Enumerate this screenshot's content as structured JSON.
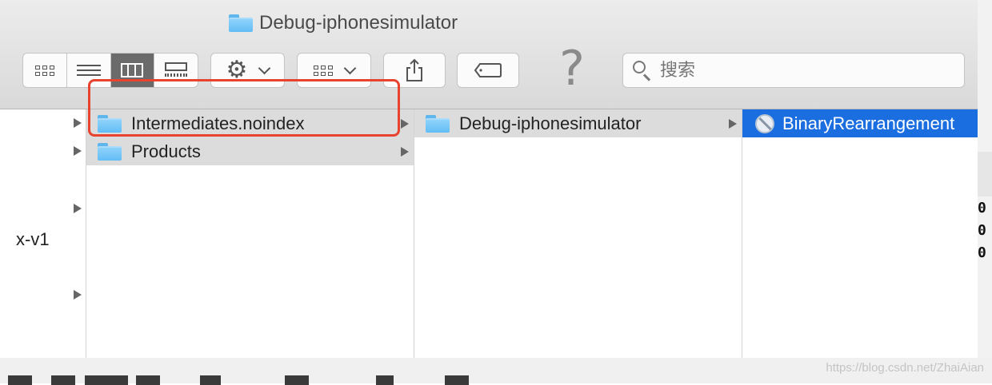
{
  "window": {
    "title": "Debug-iphonesimulator",
    "title_icon": "folder-icon"
  },
  "toolbar": {
    "view_modes": [
      "icon-view-icon",
      "list-view-icon",
      "column-view-icon",
      "gallery-view-icon"
    ],
    "active_view": "column-view",
    "action_icon": "gear-icon",
    "group_icon": "group-grid-icon",
    "share_icon": "share-icon",
    "tag_icon": "tag-icon",
    "help_glyph": "?",
    "search_placeholder": "搜索"
  },
  "columns": {
    "col0": {
      "partial_label": "x-v1"
    },
    "col1": {
      "items": [
        {
          "name": "Intermediates.noindex",
          "icon": "folder-icon",
          "selected": "gray"
        },
        {
          "name": "Products",
          "icon": "folder-icon",
          "selected": "gray"
        }
      ]
    },
    "col2": {
      "items": [
        {
          "name": "Debug-iphonesimulator",
          "icon": "folder-icon",
          "selected": "gray"
        }
      ]
    },
    "col3": {
      "items": [
        {
          "name": "BinaryRearrangement",
          "icon": "app-icon",
          "selected": "blue"
        }
      ]
    }
  },
  "right_edge_text": [
    "0",
    "0",
    "0"
  ],
  "watermark": "https://blog.csdn.net/ZhaiAian",
  "colors": {
    "selection_blue": "#1a6ee0",
    "selection_gray": "#dcdcdc",
    "annotation_red": "#e8432f"
  }
}
